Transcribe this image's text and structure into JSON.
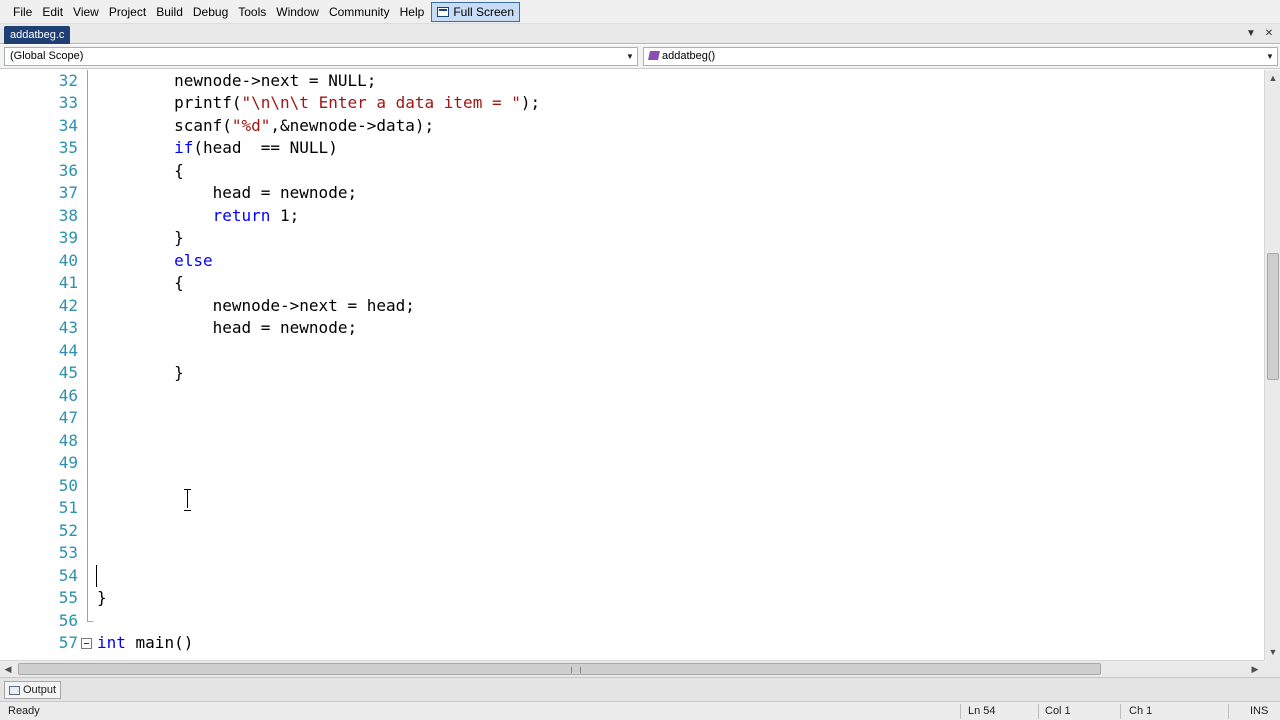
{
  "menu": {
    "items": [
      "File",
      "Edit",
      "View",
      "Project",
      "Build",
      "Debug",
      "Tools",
      "Window",
      "Community",
      "Help"
    ],
    "fullscreen_label": "Full Screen"
  },
  "tab": {
    "filename": "addatbeg.c"
  },
  "navigation": {
    "scope": "(Global Scope)",
    "member": "addatbeg()"
  },
  "editor": {
    "lines": [
      {
        "num": "32",
        "text": "        newnode->next = NULL;"
      },
      {
        "num": "33",
        "text": "        printf(\"\\n\\n\\t Enter a data item = \");"
      },
      {
        "num": "34",
        "text": "        scanf(\"%d\",&newnode->data);"
      },
      {
        "num": "35",
        "text": "        if(head  == NULL)"
      },
      {
        "num": "36",
        "text": "        {"
      },
      {
        "num": "37",
        "text": "            head = newnode;"
      },
      {
        "num": "38",
        "text": "            return 1;"
      },
      {
        "num": "39",
        "text": "        }"
      },
      {
        "num": "40",
        "text": "        else"
      },
      {
        "num": "41",
        "text": "        {"
      },
      {
        "num": "42",
        "text": "            newnode->next = head;"
      },
      {
        "num": "43",
        "text": "            head = newnode;"
      },
      {
        "num": "44",
        "text": ""
      },
      {
        "num": "45",
        "text": "        }"
      },
      {
        "num": "46",
        "text": ""
      },
      {
        "num": "47",
        "text": ""
      },
      {
        "num": "48",
        "text": ""
      },
      {
        "num": "49",
        "text": ""
      },
      {
        "num": "50",
        "text": ""
      },
      {
        "num": "51",
        "text": ""
      },
      {
        "num": "52",
        "text": ""
      },
      {
        "num": "53",
        "text": ""
      },
      {
        "num": "54",
        "text": ""
      },
      {
        "num": "55",
        "text": "}"
      },
      {
        "num": "56",
        "text": ""
      },
      {
        "num": "57",
        "text": "int main()"
      }
    ]
  },
  "output_panel": {
    "tab_label": "Output"
  },
  "status": {
    "state": "Ready",
    "line": "Ln 54",
    "col": "Col 1",
    "ch": "Ch 1",
    "mode": "INS"
  }
}
